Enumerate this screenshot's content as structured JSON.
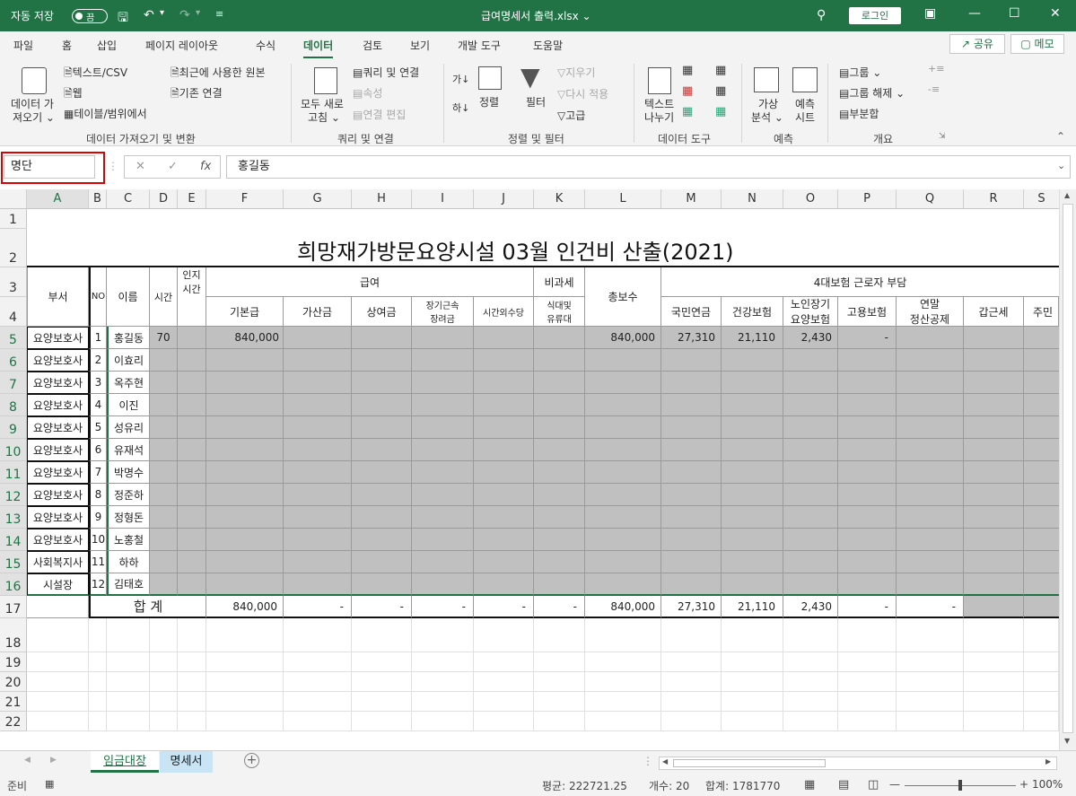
{
  "titlebar": {
    "autosave_label": "자동 저장",
    "autosave_state": "끔",
    "file_title": "급여명세서 출력.xlsx",
    "file_title_suffix": "⌄",
    "login_label": "로그인"
  },
  "menu": {
    "items": [
      "파일",
      "홈",
      "삽입",
      "페이지 레이아웃",
      "수식",
      "데이터",
      "검토",
      "보기",
      "개발 도구",
      "도움말"
    ],
    "active": "데이터",
    "share_label": "공유",
    "memo_label": "메모"
  },
  "ribbon": {
    "get_data": {
      "line1": "데이터 가",
      "line2": "져오기 ⌄"
    },
    "text_csv": "텍스트/CSV",
    "web": "웹",
    "table_range": "테이블/범위에서",
    "recent_sources": "최근에 사용한 원본",
    "existing_conn": "기존 연결",
    "refresh_all": {
      "line1": "모두 새로",
      "line2": "고침 ⌄"
    },
    "queries_conn": "쿼리 및 연결",
    "properties": "속성",
    "edit_links": "연결 편집",
    "sort_az": "가↓",
    "sort_za": "하↓",
    "sort": "정렬",
    "filter": "필터",
    "clear": "지우기",
    "reapply": "다시 적용",
    "advanced": "고급",
    "text_to_columns": {
      "line1": "텍스트",
      "line2": "나누기"
    },
    "whatif": {
      "line1": "가상",
      "line2": "분석 ⌄"
    },
    "forecast_sheet": {
      "line1": "예측",
      "line2": "시트"
    },
    "group": "그룹",
    "ungroup": "그룹 해제",
    "subtotal": "부분합",
    "groups": [
      "데이터 가져오기 및 변환",
      "쿼리 및 연결",
      "정렬 및 필터",
      "데이터 도구",
      "예측",
      "개요"
    ]
  },
  "formula_bar": {
    "name_box": "명단",
    "formula": "홍길동"
  },
  "columns": [
    "A",
    "B",
    "C",
    "D",
    "E",
    "F",
    "G",
    "H",
    "I",
    "J",
    "K",
    "L",
    "M",
    "N",
    "O",
    "P",
    "Q",
    "R",
    "S"
  ],
  "rows": [
    "1",
    "2",
    "3",
    "4",
    "5",
    "6",
    "7",
    "8",
    "9",
    "10",
    "11",
    "12",
    "13",
    "14",
    "15",
    "16",
    "17",
    "18",
    "19",
    "20",
    "21",
    "22"
  ],
  "sheet": {
    "title": "희망재가방문요양시설    03월  인건비  산출(2021)",
    "headers": {
      "dept": "부서",
      "no": "NO",
      "name": "이름",
      "hours": "시간",
      "cert_line1": "인지",
      "cert_line2": "시간",
      "salary": "급여",
      "nontax": "비과세",
      "total_pay": "총보수",
      "insurance": "4대보험 근로자 부담",
      "base": "기본급",
      "add": "가산금",
      "bonus": "상여금",
      "longterm_line1": "장기근속",
      "longterm_line2": "장려금",
      "overtime": "시간외수당",
      "meal_line1": "식대및",
      "meal_line2": "유류대",
      "pension": "국민연금",
      "health": "건강보험",
      "ltc_line1": "노인장기",
      "ltc_line2": "요양보험",
      "employ": "고용보험",
      "yearend_line1": "연말",
      "yearend_line2": "정산공제",
      "income_tax": "갑근세",
      "resident": "주민"
    },
    "employees": [
      {
        "dept": "요양보호사",
        "no": "1",
        "name": "홍길동",
        "hours": "70",
        "base": "840,000",
        "total": "840,000",
        "pension": "27,310",
        "health": "21,110",
        "ltc": "2,430",
        "employ": "-"
      },
      {
        "dept": "요양보호사",
        "no": "2",
        "name": "이효리",
        "hours": "",
        "base": "",
        "total": "",
        "pension": "",
        "health": "",
        "ltc": "",
        "employ": ""
      },
      {
        "dept": "요양보호사",
        "no": "3",
        "name": "옥주현",
        "hours": "",
        "base": "",
        "total": "",
        "pension": "",
        "health": "",
        "ltc": "",
        "employ": ""
      },
      {
        "dept": "요양보호사",
        "no": "4",
        "name": "이진",
        "hours": "",
        "base": "",
        "total": "",
        "pension": "",
        "health": "",
        "ltc": "",
        "employ": ""
      },
      {
        "dept": "요양보호사",
        "no": "5",
        "name": "성유리",
        "hours": "",
        "base": "",
        "total": "",
        "pension": "",
        "health": "",
        "ltc": "",
        "employ": ""
      },
      {
        "dept": "요양보호사",
        "no": "6",
        "name": "유재석",
        "hours": "",
        "base": "",
        "total": "",
        "pension": "",
        "health": "",
        "ltc": "",
        "employ": ""
      },
      {
        "dept": "요양보호사",
        "no": "7",
        "name": "박명수",
        "hours": "",
        "base": "",
        "total": "",
        "pension": "",
        "health": "",
        "ltc": "",
        "employ": ""
      },
      {
        "dept": "요양보호사",
        "no": "8",
        "name": "정준하",
        "hours": "",
        "base": "",
        "total": "",
        "pension": "",
        "health": "",
        "ltc": "",
        "employ": ""
      },
      {
        "dept": "요양보호사",
        "no": "9",
        "name": "정형돈",
        "hours": "",
        "base": "",
        "total": "",
        "pension": "",
        "health": "",
        "ltc": "",
        "employ": ""
      },
      {
        "dept": "요양보호사",
        "no": "10",
        "name": "노홍철",
        "hours": "",
        "base": "",
        "total": "",
        "pension": "",
        "health": "",
        "ltc": "",
        "employ": ""
      },
      {
        "dept": "사회복지사",
        "no": "11",
        "name": "하하",
        "hours": "",
        "base": "",
        "total": "",
        "pension": "",
        "health": "",
        "ltc": "",
        "employ": ""
      },
      {
        "dept": "시설장",
        "no": "12",
        "name": "김태호",
        "hours": "",
        "base": "",
        "total": "",
        "pension": "",
        "health": "",
        "ltc": "",
        "employ": ""
      }
    ],
    "totals": {
      "label": "합    계",
      "base": "840,000",
      "add": "-",
      "bonus": "-",
      "longterm": "-",
      "overtime": "-",
      "meal": "-",
      "total": "840,000",
      "pension": "27,310",
      "health": "21,110",
      "ltc": "2,430",
      "employ": "-",
      "yearend": "-"
    }
  },
  "tabs": {
    "items": [
      "임금대장",
      "명세서"
    ],
    "active": "임금대장"
  },
  "status": {
    "ready": "준비",
    "average": "평균: 222721.25",
    "count": "개수: 20",
    "sum": "합계: 1781770",
    "zoom": "100%"
  },
  "colors": {
    "accent": "#217346",
    "gray_fill": "#c0c0c0",
    "highlight": "#e00000"
  }
}
